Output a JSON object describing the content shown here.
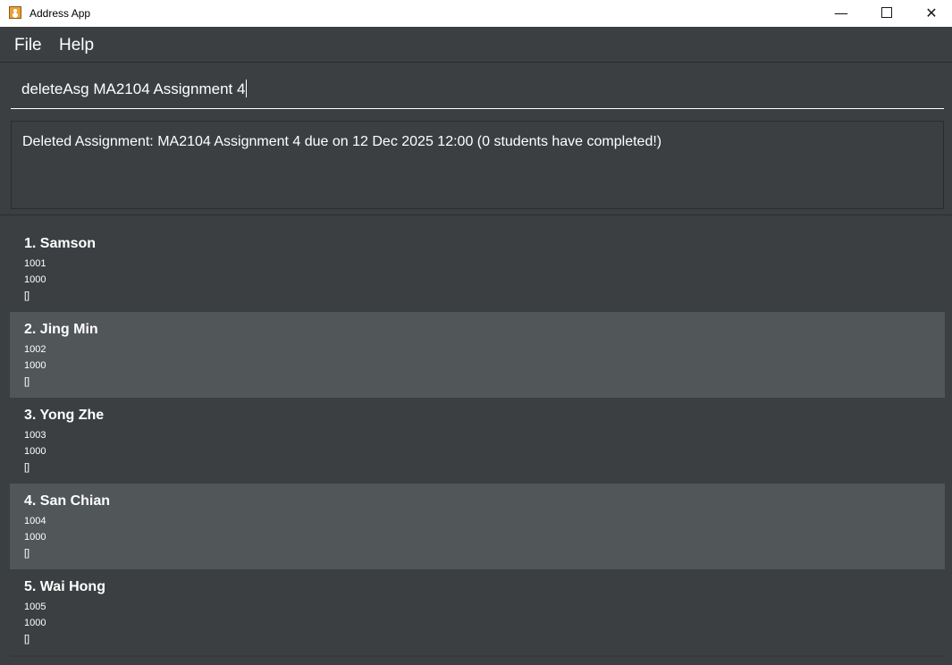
{
  "window": {
    "title": "Address App",
    "minimize_glyph": "—",
    "close_glyph": "✕"
  },
  "menu": {
    "items": [
      "File",
      "Help"
    ]
  },
  "command": {
    "value": "deleteAsg MA2104 Assignment 4"
  },
  "result": {
    "message": "Deleted Assignment: MA2104 Assignment 4 due on 12 Dec 2025 12:00 (0 students have completed!)"
  },
  "students": [
    {
      "name": "1. Samson",
      "line1": "1001",
      "line2": "1000",
      "line3": "[]"
    },
    {
      "name": "2. Jing Min",
      "line1": "1002",
      "line2": "1000",
      "line3": "[]"
    },
    {
      "name": "3. Yong Zhe",
      "line1": "1003",
      "line2": "1000",
      "line3": "[]"
    },
    {
      "name": "4. San Chian",
      "line1": "1004",
      "line2": "1000",
      "line3": "[]"
    },
    {
      "name": "5. Wai Hong",
      "line1": "1005",
      "line2": "1000",
      "line3": "[]"
    }
  ],
  "colors": {
    "background": "#3c3f41",
    "card_odd": "#3c3f41",
    "card_even": "#515658",
    "text": "#ffffff"
  }
}
